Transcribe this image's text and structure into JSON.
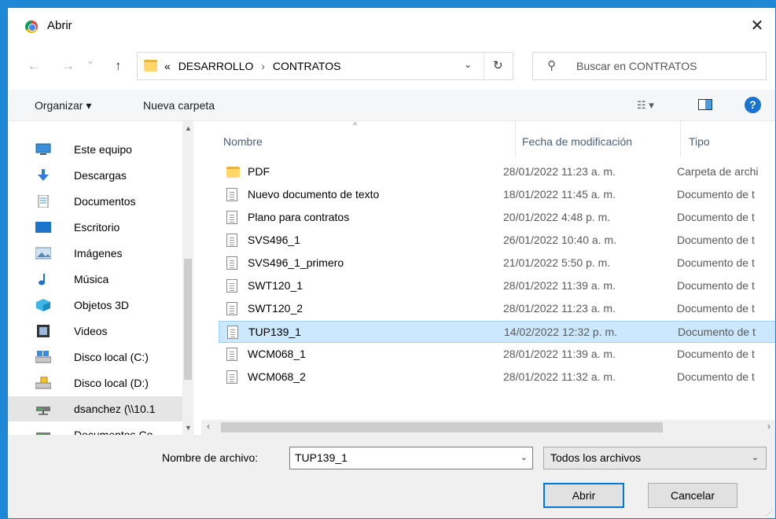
{
  "window": {
    "title": "Abrir",
    "close_glyph": "✕"
  },
  "nav": {
    "back_glyph": "←",
    "forward_glyph": "→",
    "recent_glyph": "⌄",
    "up_glyph": "↑",
    "path_prefix": "«",
    "path": [
      "DESARROLLO",
      "CONTRATOS"
    ],
    "path_sep": "›",
    "dropdown_glyph": "⌄",
    "refresh_glyph": "↻",
    "search_placeholder": "Buscar en CONTRATOS"
  },
  "toolbar": {
    "organize": "Organizar ▾",
    "new_folder": "Nueva carpeta",
    "view_glyph": "☷ ▾",
    "help": "?"
  },
  "sidebar": {
    "items": [
      {
        "label": "Este equipo",
        "icon": "computer-icon",
        "state": ""
      },
      {
        "label": "Descargas",
        "icon": "download-icon",
        "state": ""
      },
      {
        "label": "Documentos",
        "icon": "documents-icon",
        "state": ""
      },
      {
        "label": "Escritorio",
        "icon": "desktop-icon",
        "state": ""
      },
      {
        "label": "Imágenes",
        "icon": "pictures-icon",
        "state": ""
      },
      {
        "label": "Música",
        "icon": "music-icon",
        "state": ""
      },
      {
        "label": "Objetos 3D",
        "icon": "objects3d-icon",
        "state": ""
      },
      {
        "label": "Videos",
        "icon": "videos-icon",
        "state": ""
      },
      {
        "label": "Disco local (C:)",
        "icon": "drive-c-icon",
        "state": ""
      },
      {
        "label": "Disco local (D:)",
        "icon": "drive-d-icon",
        "state": ""
      },
      {
        "label": "dsanchez (\\\\10.1",
        "icon": "network-drive-icon",
        "state": "dim"
      },
      {
        "label": "Documentos Co",
        "icon": "network-drive-icon",
        "state": ""
      }
    ],
    "collapse_glyph": "⌄"
  },
  "columns": {
    "name": "Nombre",
    "date": "Fecha de modificación",
    "type": "Tipo",
    "sort_glyph": "^"
  },
  "files": [
    {
      "name": "PDF",
      "date": "28/01/2022 11:23 a. m.",
      "type": "Carpeta de archi",
      "kind": "folder",
      "selected": false
    },
    {
      "name": "Nuevo documento de texto",
      "date": "18/01/2022 11:45 a. m.",
      "type": "Documento de t",
      "kind": "file",
      "selected": false
    },
    {
      "name": "Plano para contratos",
      "date": "20/01/2022 4:48 p. m.",
      "type": "Documento de t",
      "kind": "file",
      "selected": false
    },
    {
      "name": "SVS496_1",
      "date": "26/01/2022 10:40 a. m.",
      "type": "Documento de t",
      "kind": "file",
      "selected": false
    },
    {
      "name": "SVS496_1_primero",
      "date": "21/01/2022 5:50 p. m.",
      "type": "Documento de t",
      "kind": "file",
      "selected": false
    },
    {
      "name": "SWT120_1",
      "date": "28/01/2022 11:39 a. m.",
      "type": "Documento de t",
      "kind": "file",
      "selected": false
    },
    {
      "name": "SWT120_2",
      "date": "28/01/2022 11:23 a. m.",
      "type": "Documento de t",
      "kind": "file",
      "selected": false
    },
    {
      "name": "TUP139_1",
      "date": "14/02/2022 12:32 p. m.",
      "type": "Documento de t",
      "kind": "file",
      "selected": true
    },
    {
      "name": "WCM068_1",
      "date": "28/01/2022 11:39 a. m.",
      "type": "Documento de t",
      "kind": "file",
      "selected": false
    },
    {
      "name": "WCM068_2",
      "date": "28/01/2022 11:32 a. m.",
      "type": "Documento de t",
      "kind": "file",
      "selected": false
    }
  ],
  "hscroll": {
    "left_glyph": "‹",
    "right_glyph": "›"
  },
  "footer": {
    "filename_label": "Nombre de archivo:",
    "filename_value": "TUP139_1",
    "filetype_value": "Todos los archivos",
    "open_label": "Abrir",
    "cancel_label": "Cancelar",
    "dropdown_glyph": "⌄"
  },
  "colors": {
    "accent": "#0078d7",
    "selection": "#cce8ff",
    "frame": "#1e88d6"
  }
}
